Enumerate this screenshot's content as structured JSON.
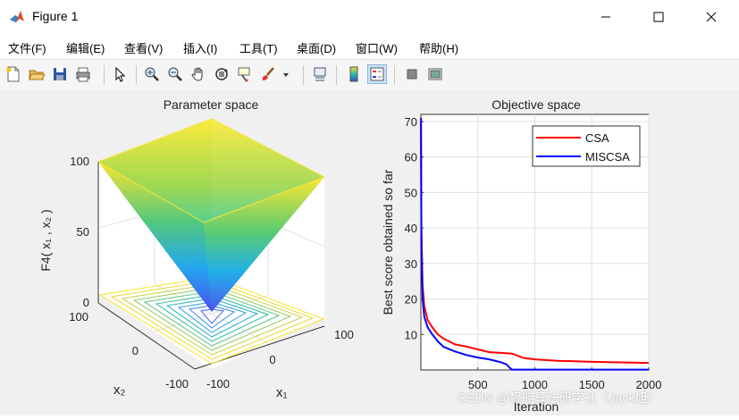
{
  "window": {
    "title": "Figure 1"
  },
  "menu": {
    "items": [
      "文件(F)",
      "编辑(E)",
      "查看(V)",
      "插入(I)",
      "工具(T)",
      "桌面(D)",
      "窗口(W)",
      "帮助(H)"
    ]
  },
  "toolbar": {
    "icons": [
      "new-figure-icon",
      "open-file-icon",
      "save-icon",
      "print-icon",
      "pointer-icon",
      "zoom-in-icon",
      "zoom-out-icon",
      "pan-hand-icon",
      "rotate-3d-icon",
      "data-cursor-icon",
      "brush-icon",
      "link-plot-icon",
      "colorbar-icon",
      "legend-icon",
      "hide-plot-tools-icon",
      "show-plot-tools-icon"
    ]
  },
  "left_plot": {
    "title": "Parameter space",
    "zlabel": "F4( x₁ , x₂ )",
    "z_ticks": [
      "100",
      "50",
      "0"
    ],
    "x2_ticks": [
      "100",
      "0",
      "-100"
    ],
    "x1_ticks": [
      "-100",
      "0",
      "100"
    ],
    "x2_label": "x₂",
    "x1_label": "x₁"
  },
  "chart_data": {
    "type": "line",
    "title": "Objective space",
    "xlabel": "Iteration",
    "ylabel": "Best score obtained so far",
    "xlim": [
      0,
      2000
    ],
    "ylim": [
      0,
      72
    ],
    "x_ticks": [
      500,
      1000,
      1500,
      2000
    ],
    "y_ticks": [
      10,
      20,
      30,
      40,
      50,
      60,
      70
    ],
    "grid": true,
    "legend_position": "top-right",
    "series": [
      {
        "name": "CSA",
        "color": "#ff0000",
        "points": [
          [
            1,
            70
          ],
          [
            5,
            40
          ],
          [
            15,
            24
          ],
          [
            30,
            18
          ],
          [
            60,
            14
          ],
          [
            100,
            12
          ],
          [
            150,
            10
          ],
          [
            200,
            8.8
          ],
          [
            300,
            7.2
          ],
          [
            400,
            6.6
          ],
          [
            500,
            5.8
          ],
          [
            600,
            5
          ],
          [
            700,
            4.8
          ],
          [
            800,
            4.6
          ],
          [
            900,
            3.4
          ],
          [
            1000,
            3
          ],
          [
            1200,
            2.6
          ],
          [
            1500,
            2.3
          ],
          [
            2000,
            2
          ]
        ]
      },
      {
        "name": "MISCSA",
        "color": "#0000ff",
        "points": [
          [
            1,
            71
          ],
          [
            5,
            35
          ],
          [
            15,
            20
          ],
          [
            30,
            15
          ],
          [
            60,
            12
          ],
          [
            100,
            10
          ],
          [
            150,
            8
          ],
          [
            200,
            6.5
          ],
          [
            300,
            5.2
          ],
          [
            400,
            4.2
          ],
          [
            500,
            3.5
          ],
          [
            600,
            3
          ],
          [
            700,
            2.2
          ],
          [
            750,
            1.6
          ],
          [
            790,
            0.3
          ],
          [
            800,
            0.1
          ],
          [
            2000,
            0.1
          ]
        ]
      }
    ]
  },
  "watermark": "CSDN @智能算法研学社（Jack旭）"
}
